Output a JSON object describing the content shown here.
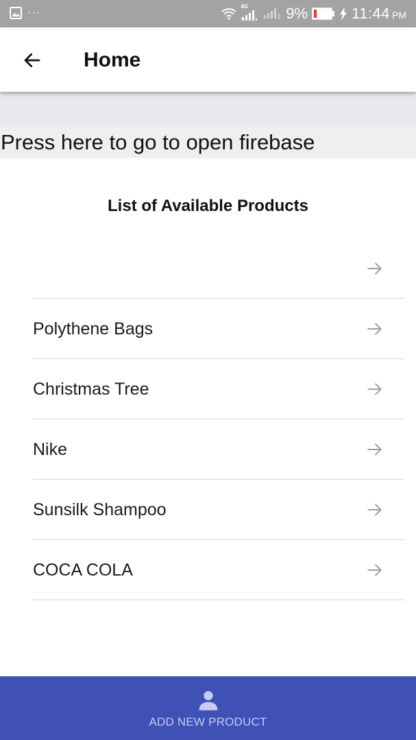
{
  "status_bar": {
    "left_dots": "···",
    "network_label": "4G",
    "battery_percent": "9%",
    "time": "11:44",
    "ampm": "PM"
  },
  "app_bar": {
    "title": "Home",
    "back_icon": "arrow-left-icon"
  },
  "firebase_link": {
    "label": "Press here to go to open firebase"
  },
  "products": {
    "heading": "List of Available Products",
    "items": [
      {
        "label": ""
      },
      {
        "label": "Polythene Bags"
      },
      {
        "label": "Christmas Tree"
      },
      {
        "label": "Nike"
      },
      {
        "label": "Sunsilk Shampoo"
      },
      {
        "label": "COCA COLA"
      }
    ],
    "row_icon": "arrow-right-icon"
  },
  "bottom_nav": {
    "label": "ADD NEW PRODUCT",
    "icon": "person-icon"
  },
  "colors": {
    "status_bar": "#a3a3a3",
    "accent": "#3f51b5",
    "bottom_label": "#c5cbf2",
    "battery_low": "#e53935"
  }
}
